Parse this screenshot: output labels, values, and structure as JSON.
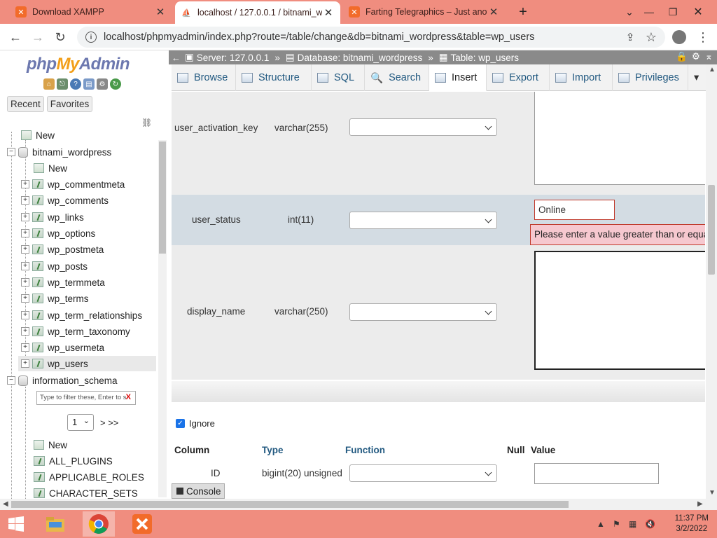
{
  "browser": {
    "tabs": [
      {
        "title": "Download XAMPP",
        "active": false
      },
      {
        "title": "localhost / 127.0.0.1 / bitnami_w",
        "active": true
      },
      {
        "title": "Farting Telegraphics – Just anoth",
        "active": false
      }
    ],
    "new_tab": "+",
    "url": "localhost/phpmyadmin/index.php?route=/table/change&db=bitnami_wordpress&table=wp_users"
  },
  "sidebar": {
    "logo": {
      "php": "php",
      "my": "My",
      "admin": "Admin"
    },
    "recent_label": "Recent",
    "favorites_label": "Favorites",
    "tree": {
      "new_root": "New",
      "db1": "bitnami_wordpress",
      "db1_new": "New",
      "db1_tables": [
        "wp_commentmeta",
        "wp_comments",
        "wp_links",
        "wp_options",
        "wp_postmeta",
        "wp_posts",
        "wp_termmeta",
        "wp_terms",
        "wp_term_relationships",
        "wp_term_taxonomy",
        "wp_usermeta",
        "wp_users"
      ],
      "db2": "information_schema",
      "filter_placeholder": "Type to filter these, Enter to s",
      "page_value": "1",
      "page_next": "> >>",
      "db2_new": "New",
      "db2_tables": [
        "ALL_PLUGINS",
        "APPLICABLE_ROLES",
        "CHARACTER_SETS"
      ]
    }
  },
  "breadcrumb": {
    "server": "Server: 127.0.0.1",
    "database": "Database: bitnami_wordpress",
    "table": "Table: wp_users",
    "sep": "»"
  },
  "tabs": [
    {
      "label": "Browse",
      "active": false
    },
    {
      "label": "Structure",
      "active": false
    },
    {
      "label": "SQL",
      "active": false
    },
    {
      "label": "Search",
      "active": false
    },
    {
      "label": "Insert",
      "active": true
    },
    {
      "label": "Export",
      "active": false
    },
    {
      "label": "Import",
      "active": false
    },
    {
      "label": "Privileges",
      "active": false
    }
  ],
  "form": {
    "rows": [
      {
        "column": "user_activation_key",
        "type": "varchar(255)"
      },
      {
        "column": "user_status",
        "type": "int(11)",
        "value": "Online",
        "error": "Please enter a value greater than or equal"
      },
      {
        "column": "display_name",
        "type": "varchar(250)"
      }
    ],
    "ignore_label": "Ignore",
    "headers": {
      "column": "Column",
      "type": "Type",
      "function": "Function",
      "null": "Null",
      "value": "Value"
    },
    "next_row": {
      "column": "ID",
      "type": "bigint(20) unsigned"
    }
  },
  "console_label": "Console",
  "taskbar": {
    "time": "11:37 PM",
    "date": "3/2/2022"
  },
  "colors": {
    "accent": "#f08d7f",
    "link": "#235a81",
    "error": "#c0392b"
  }
}
